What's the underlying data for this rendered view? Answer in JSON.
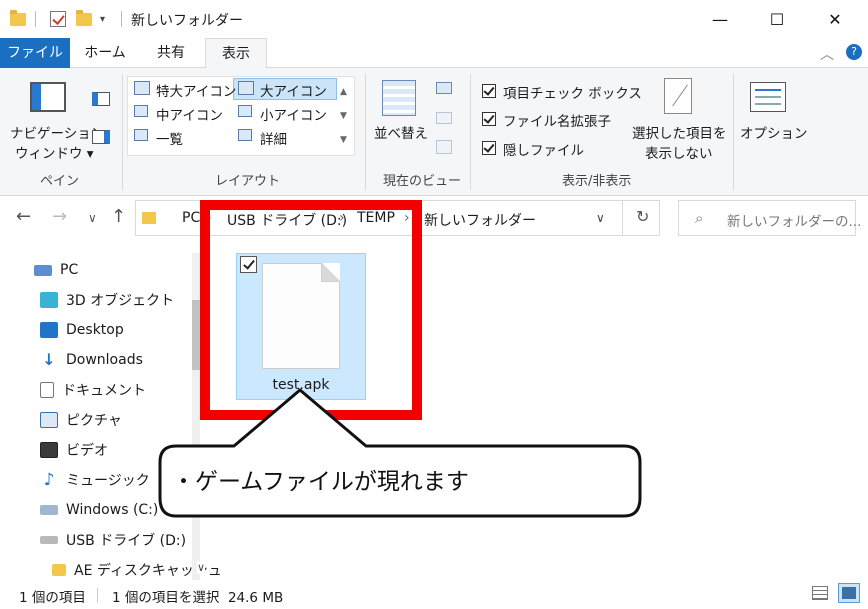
{
  "window": {
    "title": "新しいフォルダー",
    "minimize": "—",
    "maximize": "☐",
    "close": "✕"
  },
  "tabs": [
    {
      "label": "ファイル"
    },
    {
      "label": "ホーム"
    },
    {
      "label": "共有"
    },
    {
      "label": "表示"
    }
  ],
  "ribbon": {
    "pane": {
      "nav_pane_line1": "ナビゲーション",
      "nav_pane_line2": "ウィンドウ ▾",
      "label": "ペイン"
    },
    "layout": {
      "extra_large": "特大アイコン",
      "large": "大アイコン",
      "medium": "中アイコン",
      "small": "小アイコン",
      "list": "一覧",
      "details": "詳細",
      "label": "レイアウト"
    },
    "current_view": {
      "sort": "並べ替え",
      "label": "現在のビュー"
    },
    "show_hide": {
      "item_checkbox": "項目チェック ボックス",
      "file_ext": "ファイル名拡張子",
      "hidden": "隠しファイル",
      "hide_selected_line1": "選択した項目を",
      "hide_selected_line2": "表示しない",
      "label": "表示/非表示"
    },
    "options": {
      "label": "オプション"
    }
  },
  "address": {
    "crumbs": [
      "PC",
      "USB ドライブ (D:)",
      "TEMP",
      "新しいフォルダー"
    ],
    "search_placeholder": "新しいフォルダーの..."
  },
  "sidebar": {
    "items": [
      {
        "label": "PC"
      },
      {
        "label": "3D オブジェクト"
      },
      {
        "label": "Desktop"
      },
      {
        "label": "Downloads"
      },
      {
        "label": "ドキュメント"
      },
      {
        "label": "ピクチャ"
      },
      {
        "label": "ビデオ"
      },
      {
        "label": "ミュージック"
      },
      {
        "label": "Windows (C:)"
      },
      {
        "label": "USB ドライブ (D:)"
      },
      {
        "label": "AE ディスクキャッシュ"
      }
    ]
  },
  "content": {
    "file_name": "test.apk"
  },
  "callout": {
    "text": "・ゲームファイルが現れます"
  },
  "status": {
    "count": "1 個の項目",
    "selected": "1 個の項目を選択  24.6 MB"
  },
  "colors": {
    "file_tab": "#1a6fc1",
    "selection": "#cce8ff",
    "highlight_box": "#f20000"
  }
}
